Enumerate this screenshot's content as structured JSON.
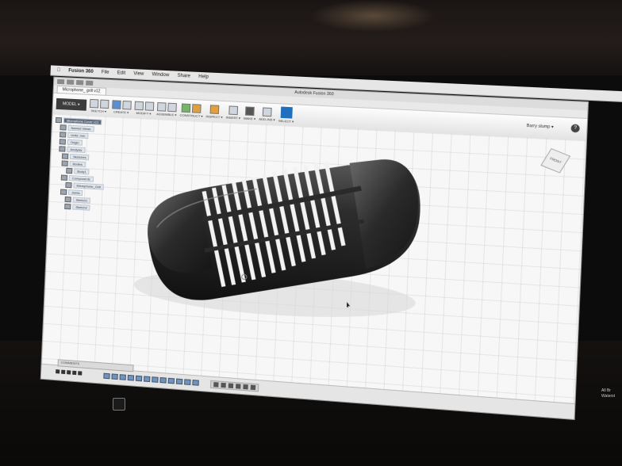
{
  "menubar": {
    "app": "Fusion 360",
    "items": [
      "File",
      "Edit",
      "View",
      "Window",
      "Share",
      "Help"
    ]
  },
  "window": {
    "title": "Autodesk Fusion 360",
    "tab": "Microphone_ grill v12"
  },
  "toolbar": {
    "workspace": "MODEL ▾",
    "groups": [
      "SKETCH ▾",
      "CREATE ▾",
      "MODIFY ▾",
      "ASSEMBLE ▾",
      "CONSTRUCT ▾",
      "INSPECT ▾",
      "INSERT ▾",
      "MAKE ▾",
      "ADD-INS ▾",
      "SELECT ▾"
    ],
    "user": "Barry stump ▾",
    "help": "?"
  },
  "browser": {
    "root": "Microphone Cover v12",
    "items": [
      "Named Views",
      "Units: mm",
      "Origin",
      "Analysis",
      "Sketches",
      "Bodies",
      "Body1",
      "Components",
      "Microphone_Grill",
      "Joints",
      "Sketch1",
      "Sketch2"
    ]
  },
  "viewcube": {
    "label": "FRONT"
  },
  "timeline": {
    "comments": "COMMENTS"
  },
  "notification": {
    "line1": "All Br",
    "line2": "Waterst"
  },
  "colors": {
    "accent": "#1f6fbf",
    "body": "#2a2a2a",
    "viewport": "#f7f7f7"
  }
}
